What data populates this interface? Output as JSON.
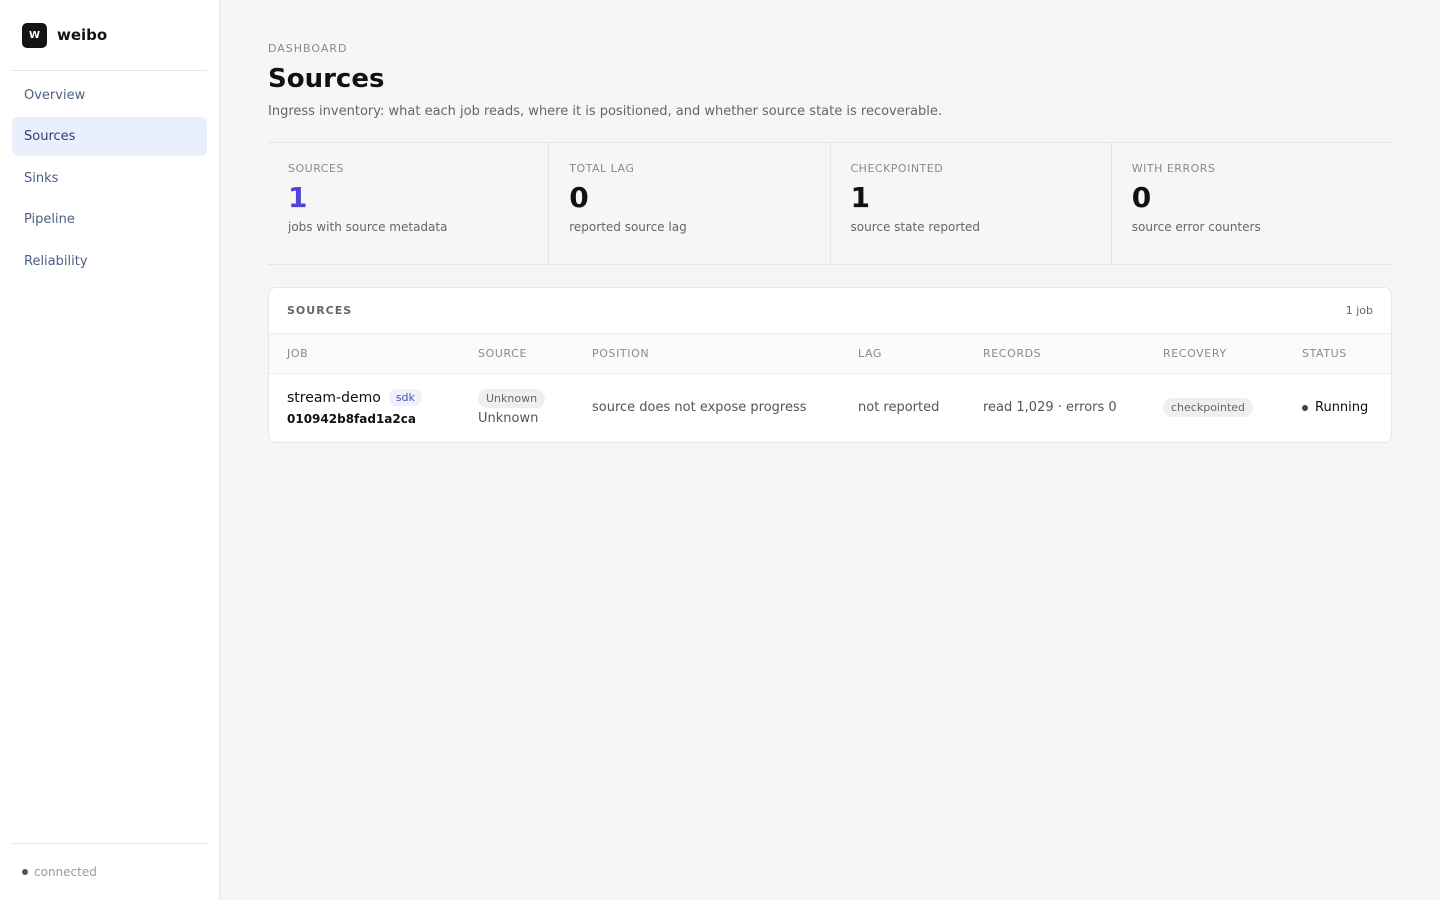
{
  "brand": {
    "logo": "W",
    "name": "weibo"
  },
  "nav": {
    "items": [
      {
        "label": "Overview"
      },
      {
        "label": "Sources",
        "active": true
      },
      {
        "label": "Sinks"
      },
      {
        "label": "Pipeline"
      },
      {
        "label": "Reliability"
      }
    ]
  },
  "footer": {
    "status": "connected"
  },
  "page": {
    "eyebrow": "DASHBOARD",
    "title": "Sources",
    "description": "Ingress inventory: what each job reads, where it is positioned, and whether source state is recoverable."
  },
  "stats": [
    {
      "label": "SOURCES",
      "value": "1",
      "sub": "jobs with source metadata"
    },
    {
      "label": "TOTAL LAG",
      "value": "0",
      "sub": "reported source lag"
    },
    {
      "label": "CHECKPOINTED",
      "value": "1",
      "sub": "source state reported"
    },
    {
      "label": "WITH ERRORS",
      "value": "0",
      "sub": "source error counters"
    }
  ],
  "table": {
    "title": "SOURCES",
    "count": "1 job",
    "columns": [
      "JOB",
      "SOURCE",
      "POSITION",
      "LAG",
      "RECORDS",
      "RECOVERY",
      "STATUS"
    ],
    "rows": [
      {
        "job_name": "stream-demo",
        "job_tag": "sdk",
        "job_id": "010942b8fad1a2ca",
        "source_pill": "Unknown",
        "source_type": "Unknown",
        "position": "source does not expose progress",
        "lag": "not reported",
        "records": "read 1,029 · errors 0",
        "recovery": "checkpointed",
        "status": "Running"
      }
    ]
  },
  "colors": {
    "accent": "#5046d8",
    "active_nav_bg": "#eaeffc"
  }
}
